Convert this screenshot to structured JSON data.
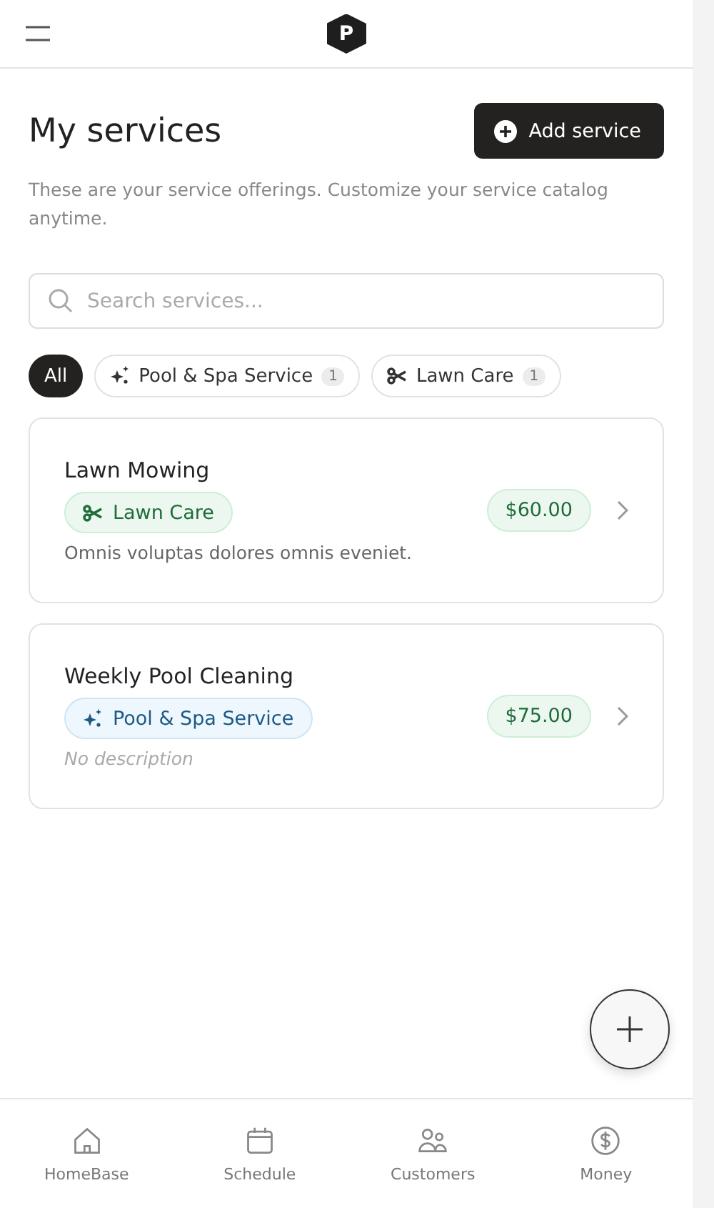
{
  "header": {
    "logo": "P"
  },
  "page": {
    "title": "My services",
    "subtitle": "These are your service offerings. Customize your service catalog anytime.",
    "add_button": "Add service"
  },
  "search": {
    "placeholder": "Search services..."
  },
  "filters": [
    {
      "label": "All",
      "selected": true
    },
    {
      "label": "Pool & Spa Service",
      "count": "1",
      "kind": "sparkle",
      "selected": false
    },
    {
      "label": "Lawn Care",
      "count": "1",
      "kind": "scissors",
      "selected": false
    }
  ],
  "services": [
    {
      "name": "Lawn Mowing",
      "category": {
        "label": "Lawn Care",
        "kind": "scissors"
      },
      "price": "$60.00",
      "description": "Omnis voluptas dolores omnis eveniet.",
      "has_description": true
    },
    {
      "name": "Weekly Pool Cleaning",
      "category": {
        "label": "Pool & Spa Service",
        "kind": "sparkle"
      },
      "price": "$75.00",
      "description": "No description",
      "has_description": false
    }
  ],
  "nav": [
    {
      "label": "HomeBase",
      "kind": "home"
    },
    {
      "label": "Schedule",
      "kind": "calendar"
    },
    {
      "label": "Customers",
      "kind": "people"
    },
    {
      "label": "Money",
      "kind": "dollar"
    }
  ]
}
